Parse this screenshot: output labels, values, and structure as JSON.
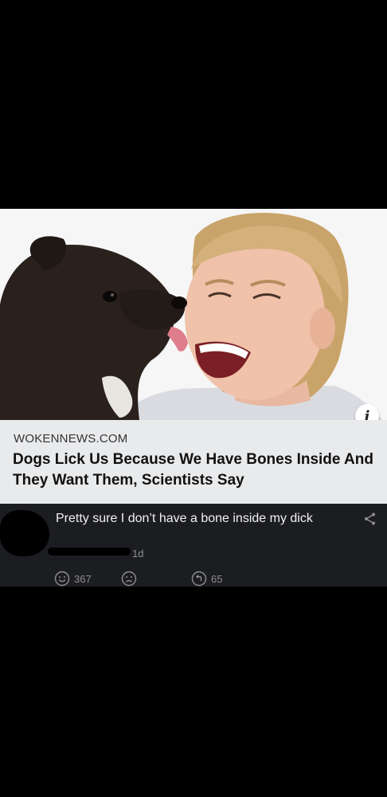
{
  "link_preview": {
    "domain": "WOKENNEWS.COM",
    "title": "Dogs Lick Us Because We Have Bones Inside And They Want Them, Scientists Say",
    "info_icon_glyph": "i",
    "image_subject": "dog licking laughing woman"
  },
  "comment": {
    "text": "Pretty sure I don’t have a bone inside my dick",
    "age": "1d",
    "reactions": {
      "like_count": "367",
      "reply_count": "65"
    },
    "icons": [
      "smile-icon",
      "sad-icon",
      "reply-icon",
      "share-icon"
    ]
  },
  "colors": {
    "background": "#000000",
    "card_background": "#e9eaec",
    "comment_background": "#1c1d21",
    "muted_text": "#8d8d93"
  }
}
